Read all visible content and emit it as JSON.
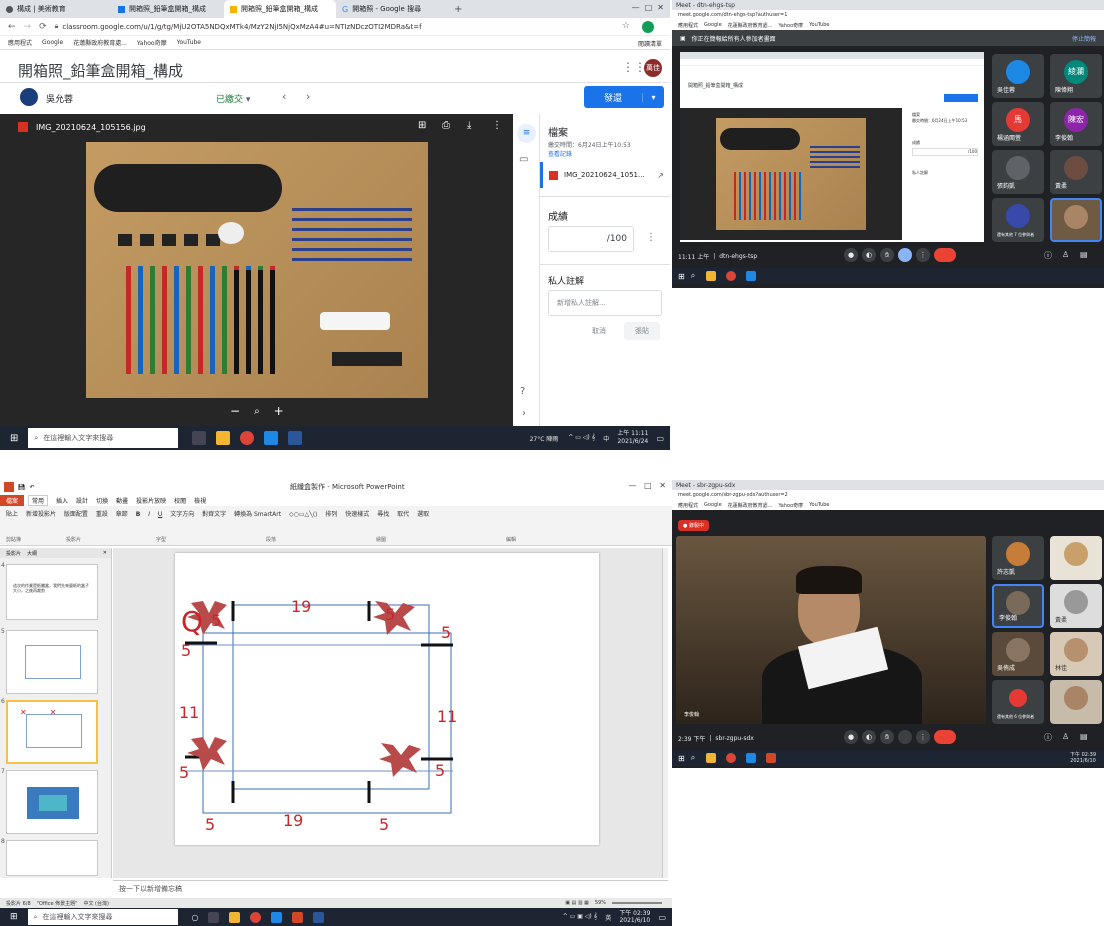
{
  "colors": {
    "classroom_blue": "#1a73e8",
    "meet_dark": "#202124",
    "taskbar": "#1d2532",
    "ppt_orange": "#d24726",
    "red_mark": "#c8262c"
  },
  "q1": {
    "tabs": [
      "構成 | 美術教育",
      "開箱照_鉛筆盒開箱_構成",
      "開箱照_鉛筆盒開箱_構成",
      "開箱照 - Google 搜尋"
    ],
    "new_tab": "+",
    "url": "classroom.google.com/u/1/g/tg/MjU2OTA5NDQxMTk4/MzY2NjI5NjQxMzA4#u=NTIzNDczOTI2MDRa&t=f",
    "bookmarks": [
      "應用程式",
      "Google",
      "花蓮縣政府教育處...",
      "Yahoo奇摩",
      "YouTube"
    ],
    "bookmarks_right": "閱讀清單",
    "assignment_title": "開箱照_鉛筆盒開箱_構成",
    "avatar_text": "萬佳",
    "student_name": "吳允蓉",
    "status": "已繳交",
    "return_button": "發還",
    "file_name": "IMG_20210624_105156.jpg",
    "panel_title": "檔案",
    "submitted_time": "繳交時間：6月24日上午10:53",
    "history_link": "查看記錄",
    "file_short": "IMG_20210624_1051...",
    "grade_label": "成績",
    "grade_value": "/100",
    "note_label": "私人註解",
    "note_placeholder": "新增私人註解...",
    "cancel_btn": "取消",
    "post_btn": "張貼",
    "zoom_minus": "−",
    "zoom_plus": "+",
    "search_taskbar": "在這裡輸入文字來搜尋",
    "weather": "27°C 陣雨",
    "ime": "中",
    "time": "上午 11:11",
    "date": "2021/6/24"
  },
  "q2": {
    "tab": "Meet - dtn-ehgs-tsp",
    "url": "meet.google.com/dtn-ehgs-tsp?authuser=1",
    "bookmarks": [
      "應用程式",
      "Google",
      "花蓮縣政府教育處...",
      "Yahoo奇摩",
      "YouTube"
    ],
    "banner": "你正在簡報給所有人參加者畫面",
    "banner_right": "停止簡報",
    "clock": "11:11 上午",
    "code": "dtn-ehgs-tsp",
    "participants": [
      {
        "name": "吳佳蓉",
        "initial": "",
        "color": "#1e88e5"
      },
      {
        "name": "陳偉翔",
        "initial": "綾瀾",
        "color": "#00897b"
      },
      {
        "name": "楊涵閩萱",
        "initial": "馬",
        "color": "#e53935"
      },
      {
        "name": "李俊翰",
        "initial": "陳宏",
        "color": "#8e24aa"
      },
      {
        "name": "張鈞凱",
        "initial": "",
        "color": "#5f6368"
      },
      {
        "name": "黃柔",
        "initial": "",
        "color": "#6d4c41"
      },
      {
        "name": "還有其他 7 位參與者",
        "initial": "",
        "color": "#3949ab"
      },
      {
        "name": "",
        "initial": "",
        "color": "#795548"
      }
    ]
  },
  "q3": {
    "window_title": "紙纖盒製作 - Microsoft PowerPoint",
    "ribbon_tabs": [
      "檔案",
      "常用",
      "插入",
      "設計",
      "切換",
      "動畫",
      "投影片放映",
      "校閱",
      "檢視"
    ],
    "ribbon_groups": [
      "剪貼簿",
      "投影片",
      "字型",
      "段落",
      "繪圖",
      "編輯"
    ],
    "ribbon_buttons": [
      "貼上",
      "新增投影片",
      "版面配置",
      "重設",
      "章節",
      "文字方向",
      "對齊文字",
      "轉換為 SmartArt",
      "排列",
      "快速樣式",
      "尋找",
      "取代",
      "選取"
    ],
    "pane_tabs": [
      "投影片",
      "大綱"
    ],
    "slide_numbers": [
      "4",
      "5",
      "6",
      "7",
      "8"
    ],
    "thumb4_text": "這次的作業是紙纖盒，我們先來量紙的盒子大小，之後再裁剪",
    "labels": {
      "corner_top_left": "5",
      "top": "19",
      "top_right": "5",
      "right_top": "5",
      "left_top": "5",
      "left_mid": "11",
      "right_mid": "11",
      "left_bottom": "5",
      "right_bottom": "5",
      "bottom_left": "5",
      "bottom": "19",
      "bottom_right": "5",
      "q_mark": "Q"
    },
    "notes_placeholder": "按一下以新增備忘稿",
    "status_left": "投影片 6/8",
    "status_theme": "\"Office 佈景主題\"",
    "status_lang": "中文 (台灣)",
    "zoom": "59%",
    "search_taskbar": "在這裡輸入文字來搜尋",
    "ime": "英",
    "time": "下午 02:39",
    "date": "2021/6/10"
  },
  "q4": {
    "tab": "Meet - sbr-zgpu-sdx",
    "url": "meet.google.com/sbr-zgpu-sdx?authuser=2",
    "bookmarks": [
      "應用程式",
      "Google",
      "花蓮縣政府教育處...",
      "Yahoo奇摩",
      "YouTube"
    ],
    "rec": "錄製中",
    "presenter_name": "李俊翰",
    "clock": "2:39 下午",
    "code": "sbr-zgpu-sdx",
    "participants": [
      {
        "name": "許志凱"
      },
      {
        "name": ""
      },
      {
        "name": "李俊翰"
      },
      {
        "name": "黃柔"
      },
      {
        "name": "吳侑成"
      },
      {
        "name": "林佳"
      },
      {
        "name": "還有其他 6 位參與者"
      },
      {
        "name": ""
      }
    ],
    "time": "下午 02:39",
    "date": "2021/6/10"
  }
}
